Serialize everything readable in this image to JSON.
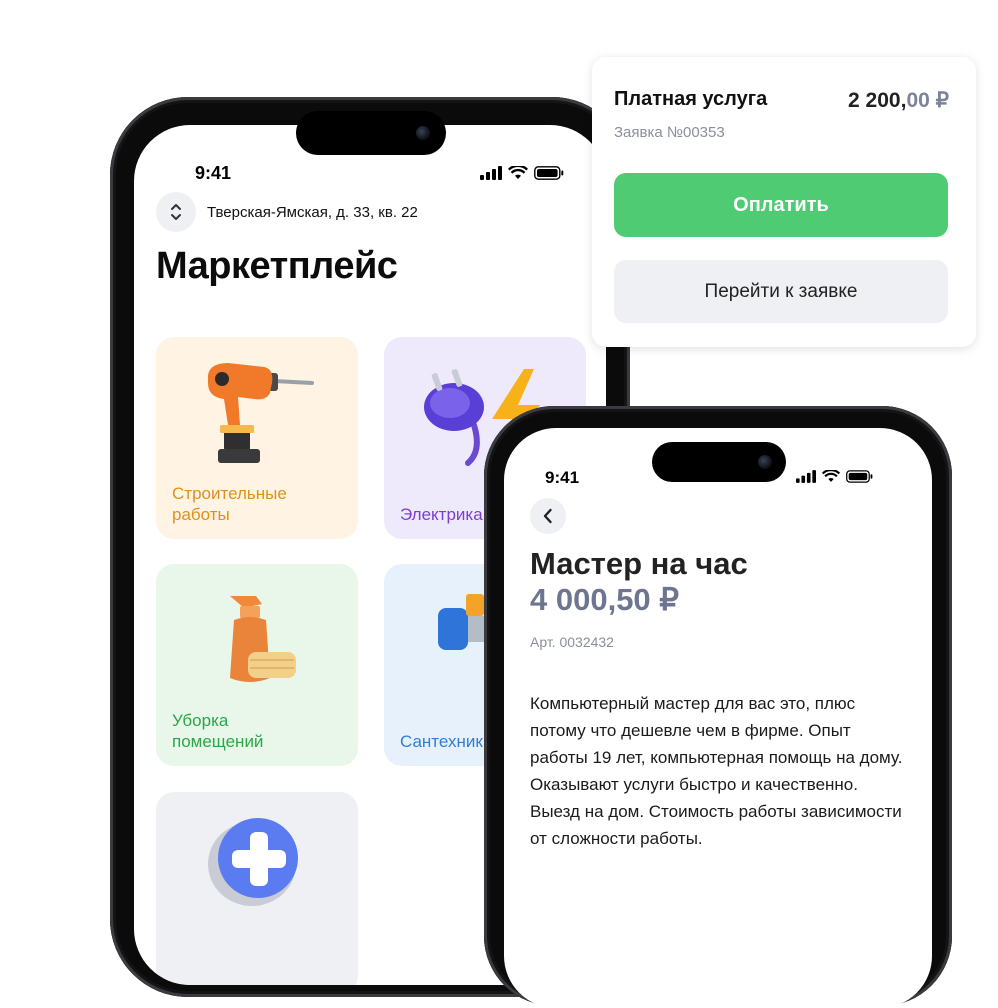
{
  "marketplace_phone": {
    "status": {
      "time": "9:41"
    },
    "address": "Тверская-Ямская, д. 33, кв. 22",
    "title": "Маркетплейс",
    "categories": [
      {
        "label": "Строительные\nработы",
        "icon": "drill-icon",
        "bg": "#fff3e3",
        "color": "#e0901a"
      },
      {
        "label": "Электрика",
        "icon": "plug-lightning-icon",
        "bg": "#efe9fc",
        "color": "#7a3fcf"
      },
      {
        "label": "Уборка\nпомещений",
        "icon": "spray-bottle-icon",
        "bg": "#e8f7ea",
        "color": "#2aa845"
      },
      {
        "label": "Сантехника",
        "icon": "pipe-icon",
        "bg": "#e7f1fc",
        "color": "#2f7fd6"
      },
      {
        "label": "",
        "icon": "plus-icon",
        "bg": "#eef0f3",
        "color": "#444"
      }
    ]
  },
  "payment_card": {
    "title": "Платная услуга",
    "amount_int": "2 200,",
    "amount_frac": "00 ₽",
    "request": "Заявка №00353",
    "pay_button": "Оплатить",
    "goto_button": "Перейти к заявке",
    "colors": {
      "pay": "#4ecb73"
    }
  },
  "service_phone": {
    "status": {
      "time": "9:41"
    },
    "title": "Мастер на час",
    "price": "4 000,50 ₽",
    "article": "Арт. 0032432",
    "description": "Компьютерный мастер для вас это, плюс потому что дешевле чем в фирме. Опыт работы 19 лет, компьютерная помощь на дому. Оказывают услуги быстро и качественно. Выезд на дом. Стоимость работы зависимости от сложности работы."
  }
}
